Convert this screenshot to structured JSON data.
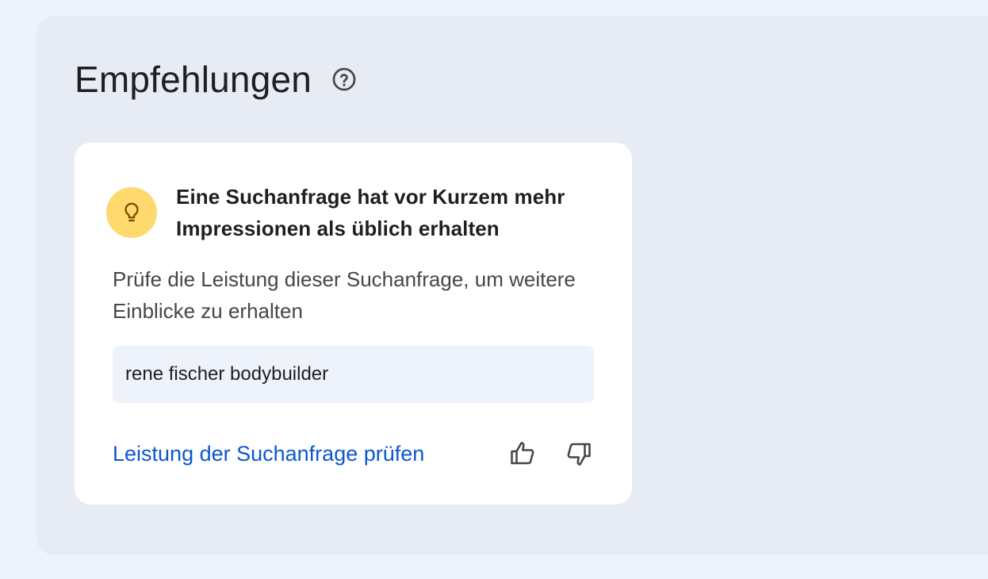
{
  "section": {
    "title": "Empfehlungen",
    "help_icon": "help-circle-icon"
  },
  "card": {
    "icon": "lightbulb-icon",
    "icon_bg_color": "#fdd96e",
    "title": "Eine Suchanfrage hat vor Kurzem mehr Impressionen als üblich erhalten",
    "description": "Prüfe die Leistung dieser Suchanfrage, um weitere Einblicke zu erhalten",
    "query": "rene fischer bodybuilder",
    "action_label": "Leistung der Suchanfrage prüfen",
    "action_color": "#0b57d0",
    "feedback": {
      "positive_icon": "thumb-up-icon",
      "negative_icon": "thumb-down-icon"
    }
  }
}
